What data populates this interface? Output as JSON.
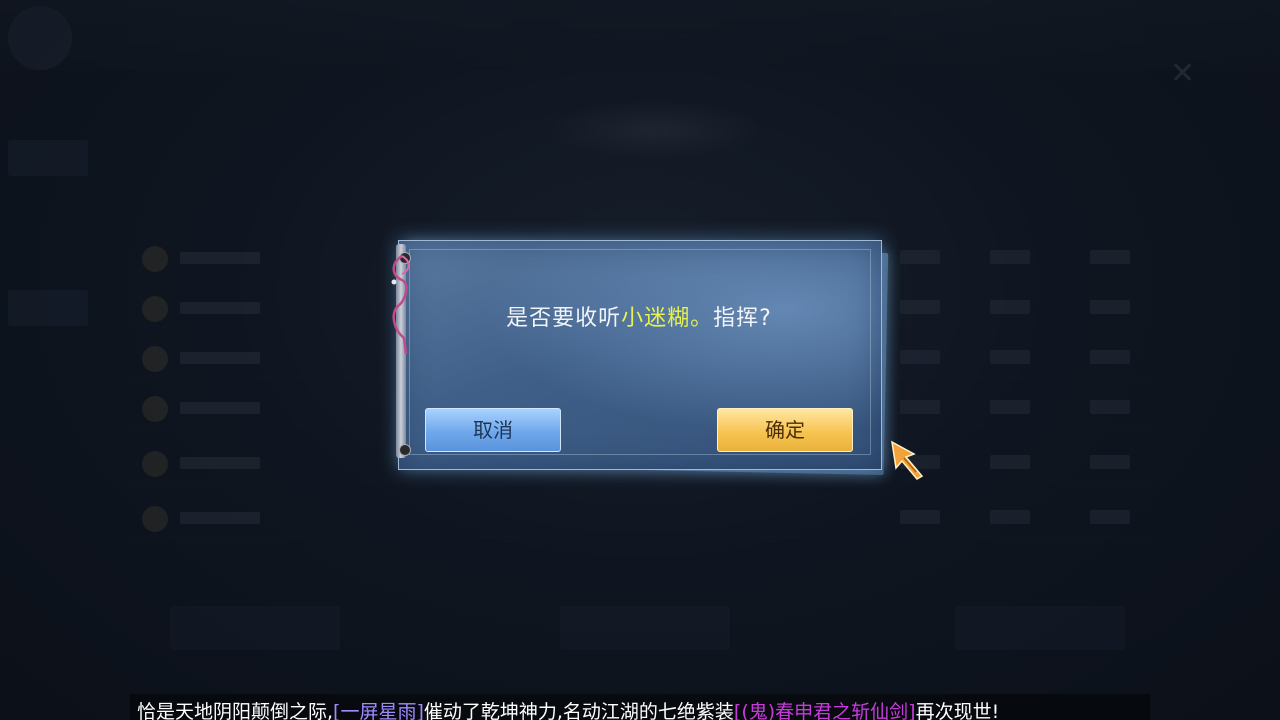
{
  "dialog": {
    "message_prefix": "是否要收听",
    "commander_name": "小迷糊。",
    "message_suffix": "指挥?",
    "cancel_label": "取消",
    "confirm_label": "确定"
  },
  "announcement": {
    "part1": "恰是天地阴阳颠倒之际,",
    "player_tag": "[一屏星雨]",
    "part2": "催动了乾坤神力,名动江湖的七绝紫装",
    "item_tag": "[(鬼)春申君之斩仙剑]",
    "part3": "再次现世!"
  },
  "colors": {
    "highlight_name": "#e8f24a",
    "player_tag": "#9e8cff",
    "item_tag": "#c73bdc",
    "cancel_button": "#6fa8ec",
    "confirm_button": "#f7c453"
  },
  "icons": {
    "close": "close-icon",
    "cursor": "arrow-cursor-icon",
    "ribbon": "scroll-ribbon-icon"
  }
}
